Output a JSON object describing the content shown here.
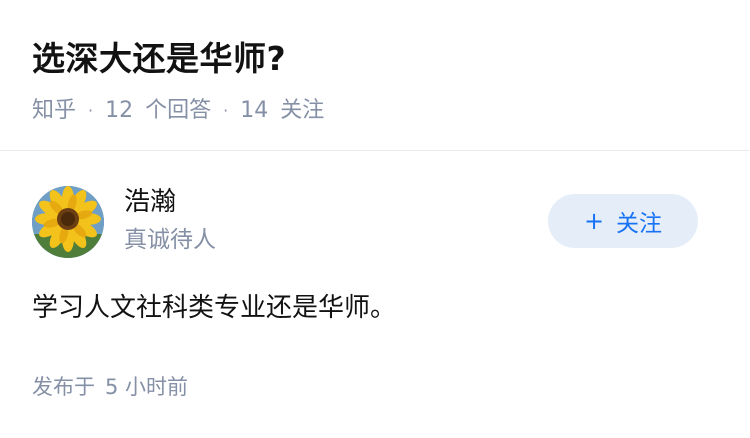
{
  "question": {
    "title": "选深大还是华师?",
    "meta": {
      "source": "知乎",
      "answer_count": "12",
      "answer_label": "个回答",
      "follow_count": "14",
      "follow_label": "关注"
    }
  },
  "author": {
    "name": "浩瀚",
    "bio": "真诚待人",
    "avatar_icon": "sunflower-avatar"
  },
  "follow_button": {
    "icon": "+",
    "label": "关注"
  },
  "body": {
    "text": "学习人文社科类专业还是华师。"
  },
  "footer": {
    "published_label": "发布于",
    "published_time": "5 小时前"
  },
  "colors": {
    "title": "#121212",
    "meta": "#8590a6",
    "accent": "#1772f6",
    "button_bg": "#e5eef8"
  }
}
